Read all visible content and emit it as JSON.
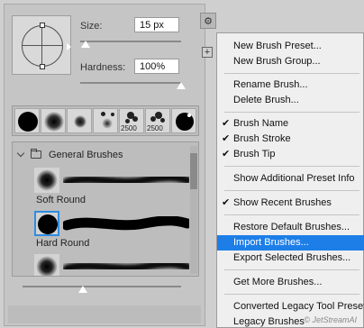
{
  "size": {
    "label": "Size:",
    "value": "15 px",
    "slider_fraction": 0.05
  },
  "hardness": {
    "label": "Hardness:",
    "value": "100%",
    "slider_fraction": 1.0
  },
  "recent_brushes": [
    {
      "type": "hard"
    },
    {
      "type": "soft"
    },
    {
      "type": "soft-small"
    },
    {
      "type": "soft-dots"
    },
    {
      "type": "scatter",
      "count": "2500"
    },
    {
      "type": "scatter2",
      "count": "2500"
    },
    {
      "type": "hard-mini"
    }
  ],
  "group": {
    "name": "General Brushes"
  },
  "brushes": [
    {
      "name": "Soft Round",
      "selected": false
    },
    {
      "name": "Hard Round",
      "selected": true
    },
    {
      "name": "",
      "selected": false
    }
  ],
  "menu": {
    "items": [
      {
        "label": "New Brush Preset...",
        "checked": false
      },
      {
        "label": "New Brush Group...",
        "checked": false
      },
      {
        "label": "Rename Brush...",
        "checked": false
      },
      {
        "label": "Delete Brush...",
        "checked": false
      },
      {
        "label": "Brush Name",
        "checked": true
      },
      {
        "label": "Brush Stroke",
        "checked": true
      },
      {
        "label": "Brush Tip",
        "checked": true
      },
      {
        "label": "Show Additional Preset Info",
        "checked": false
      },
      {
        "label": "Show Recent Brushes",
        "checked": true
      },
      {
        "label": "Restore Default Brushes...",
        "checked": false
      },
      {
        "label": "Import Brushes...",
        "checked": false,
        "highlighted": true
      },
      {
        "label": "Export Selected Brushes...",
        "checked": false
      },
      {
        "label": "Get More Brushes...",
        "checked": false
      },
      {
        "label": "Converted Legacy Tool Presets",
        "checked": false
      },
      {
        "label": "Legacy Brushes",
        "checked": false
      }
    ]
  },
  "checkmark": "✔",
  "watermark": "© JetStreamAI",
  "colors": {
    "highlight": "#1e7ee7",
    "selection_border": "#2f8de0"
  }
}
